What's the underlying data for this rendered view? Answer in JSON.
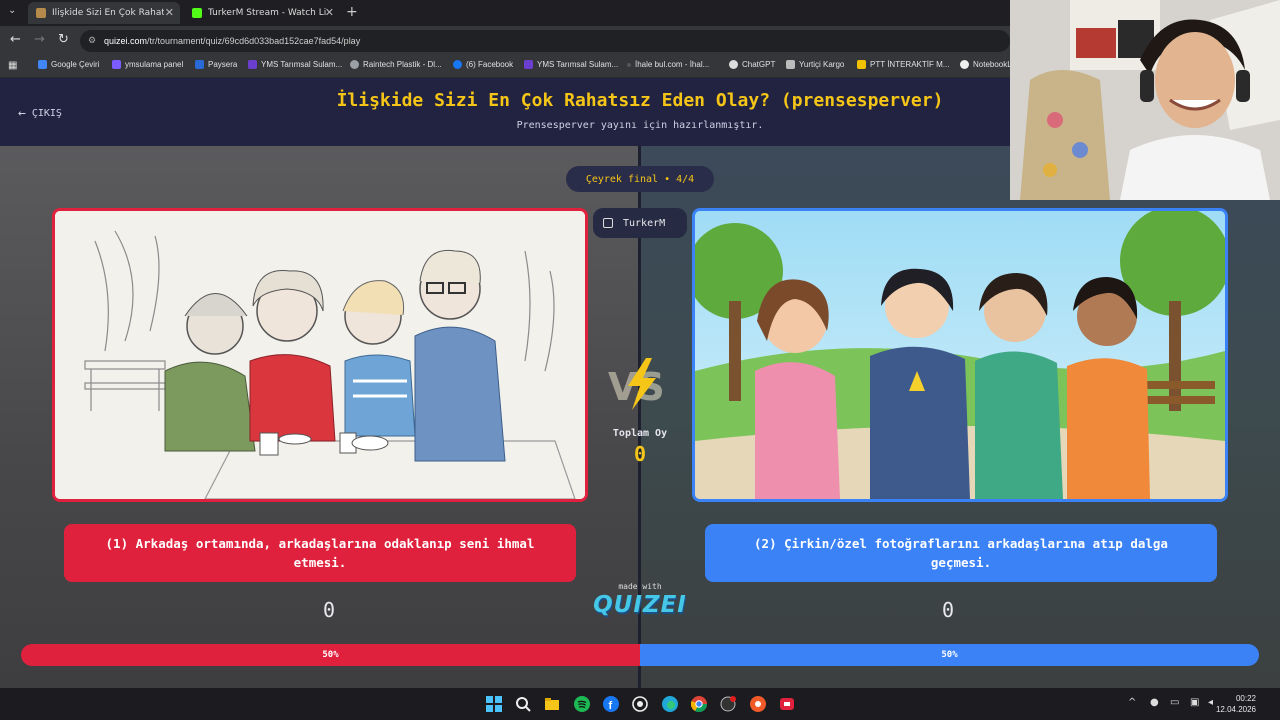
{
  "browser": {
    "tabs": [
      {
        "label": "İlişkide Sizi En Çok Rahatsız Eden",
        "favicon_color": "#b58a4a",
        "active": true
      },
      {
        "label": "TurkerM Stream - Watch Live o",
        "favicon_color": "#53fc18",
        "active": false
      }
    ],
    "url_host": "quizei.com",
    "url_path": "/tr/tournament/quiz/69cd6d033bad152cae7fad54/play",
    "bookmarks": [
      {
        "label": "Google Çeviri",
        "color": "#4285f4"
      },
      {
        "label": "ymsulama panel",
        "color": "#7b5cff"
      },
      {
        "label": "Paysera",
        "color": "#2a6ad8"
      },
      {
        "label": "YMS Tarımsal Sulam...",
        "color": "#6a3fd0"
      },
      {
        "label": "Raintech Plastik - Dl...",
        "color": "#9aa0a6"
      },
      {
        "label": "(6) Facebook",
        "color": "#1877f2"
      },
      {
        "label": "YMS Tarımsal Sulam...",
        "color": "#6a3fd0"
      },
      {
        "label": "İhale bul.com - İhal...",
        "color": "#555"
      },
      {
        "label": "ChatGPT",
        "color": "#444"
      },
      {
        "label": "Yurtiçi Kargo",
        "color": "#888"
      },
      {
        "label": "PTT İNTERAKTİF M...",
        "color": "#f2c200"
      },
      {
        "label": "NotebookLM",
        "color": "#222"
      }
    ]
  },
  "header": {
    "exit_label": "ÇIKIŞ",
    "title": "İlişkide Sizi En Çok Rahatsız Eden Olay? (prensesperver)",
    "subtitle": "Prensesperver yayını için hazırlanmıştır."
  },
  "round_label": "Çeyrek final • 4/4",
  "streamer_label": "TurkerM",
  "total": {
    "label": "Toplam Oy",
    "value": "0"
  },
  "options": [
    {
      "text": "(1) Arkadaş ortamında, arkadaşlarına odaklanıp seni ihmal etmesi.",
      "votes": "0",
      "percent_label": "50%",
      "percent": 50,
      "color": "#e0213d"
    },
    {
      "text": "(2) Çirkin/özel fotoğraflarını arkadaşlarına atıp dalga geçmesi.",
      "votes": "0",
      "percent_label": "50%",
      "percent": 50,
      "color": "#3b82f6"
    }
  ],
  "branding": {
    "made_with": "made with",
    "name": "QUIZEI"
  },
  "taskbar": {
    "time": "00:22",
    "date": "12.04.2026"
  }
}
